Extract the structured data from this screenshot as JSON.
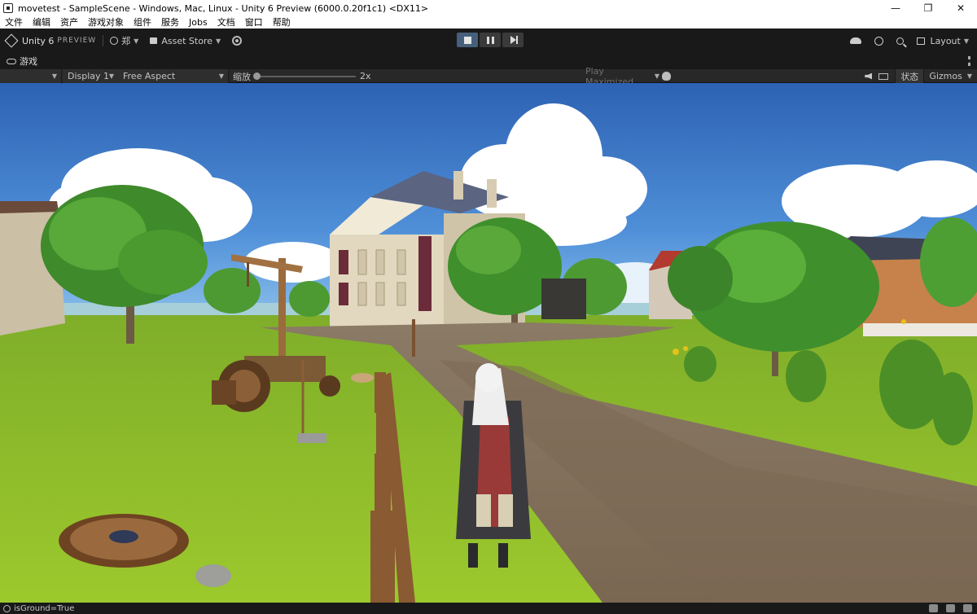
{
  "window": {
    "title": "movetest - SampleScene - Windows, Mac, Linux - Unity 6 Preview (6000.0.20f1c1) <DX11>",
    "controls": {
      "minimize": "—",
      "restore": "❐",
      "close": "✕"
    }
  },
  "menu": [
    "文件",
    "编辑",
    "资产",
    "游戏对象",
    "组件",
    "服务",
    "Jobs",
    "文档",
    "窗口",
    "帮助"
  ],
  "toolbar": {
    "brand": "Unity 6",
    "brand_suffix": "PREVIEW",
    "account": "郑",
    "asset_store": "Asset Store",
    "layout": "Layout",
    "play_state": "playing"
  },
  "tab": {
    "label": "游戏"
  },
  "game_bar": {
    "display": "Display 1",
    "aspect": "Free Aspect",
    "scale_label": "缩放",
    "scale_value": "2x",
    "scale_fraction": 0.0,
    "play_mode": "Play Maximized",
    "status": "状态",
    "gizmos": "Gizmos"
  },
  "status_bar": {
    "message": "isGround=True"
  },
  "colors": {
    "editor_bg": "#191919",
    "sky_top": "#2f66b8",
    "grass": "#8ebd2a",
    "path": "#8d7b66",
    "play_active": "#46607c"
  }
}
